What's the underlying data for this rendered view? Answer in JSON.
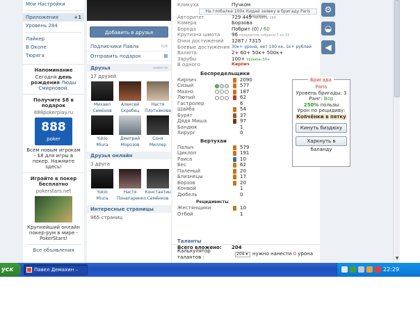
{
  "leftnav": {
    "items_top": [
      "Мои Настройки"
    ],
    "applications": {
      "label": "Приложения",
      "count": "+1"
    },
    "items_mid": [
      "Уровень 284"
    ],
    "items_links": [
      "Лайкер",
      "В Окопе",
      "Тюряга"
    ],
    "reminder": {
      "title": "Напоминание",
      "text_prefix": "Сегодня",
      "bold": "день рождения",
      "name": "Люды Смирновой."
    },
    "ad1": {
      "title": "Получите $8 в подарок",
      "site": "888pokerplay.ru",
      "logo_text": "888",
      "logo_sub": "poker",
      "text": "Всем новым игрокам - $8 для игры в покер. Нажмите здесь!"
    },
    "ad2": {
      "title": "Играйте в покер бесплатно",
      "site": "pokerstars.net",
      "text": "Крупнейший онлайн покер-рум в мире - PokerStars!"
    },
    "all_ads": "Все объявления"
  },
  "center": {
    "add_friend": "Добавить в друзья",
    "subscribers": {
      "label": "Подписчики Павла",
      "count": "628"
    },
    "send_gift": "Отправить подарок",
    "friends": {
      "title": "Друзья",
      "more": "новости",
      "count": "17 друзей",
      "people": [
        {
          "first": "Михаил",
          "last": "Семёнов"
        },
        {
          "first": "Алексей",
          "last": "Скребец"
        },
        {
          "first": "Настя",
          "last": "Плотникова"
        },
        {
          "first": "Yukio",
          "last": "Miura"
        },
        {
          "first": "Дмитрий",
          "last": "Морозов"
        },
        {
          "first": "Соня",
          "last": "Миллер"
        }
      ]
    },
    "online": {
      "title": "Друзья онлайн",
      "count": "3 друга",
      "people": [
        {
          "first": "Yukio",
          "last": "Miura"
        },
        {
          "first": "Настя",
          "last": "Понапаренко"
        },
        {
          "first": "Константин",
          "last": "Семёнков"
        }
      ]
    },
    "interesting": {
      "title": "Интересные страницы",
      "count": "965 страниц"
    }
  },
  "profile": {
    "status": "На глобалке 100к Кидай заявку в бригаду Paris Бошман",
    "rows": [
      {
        "label": "Кликуха",
        "value": "Пучком",
        "extra": ""
      },
      {
        "label": "Авторитет",
        "value": "729 449",
        "extra": "Уровень 284"
      },
      {
        "label": "Камера",
        "value": "Борзова",
        "extra": ""
      },
      {
        "label": "Борода",
        "value": "Побрит (0)",
        "extra": "60"
      },
      {
        "label": "Крутизна шмота",
        "value": "96",
        "extra": "предметов собрано 7 из 33"
      },
      {
        "label": "Очки достижений",
        "value": "1287 / 7315",
        "extra": ""
      },
      {
        "label": "Боевые достижения",
        "value": "30к+ урона, нет 100 кк, 1к+ рублей",
        "extra": ""
      },
      {
        "label": "Валюта",
        "value": "2+ 60+ 50к+ 500к+",
        "extra": ""
      },
      {
        "label": "Зарубы",
        "value": "100+",
        "extra": "Уровень 50+"
      },
      {
        "label": "В одного",
        "value": "Кирпич",
        "extra": ""
      }
    ]
  },
  "skills": {
    "title": "Беспредельщики",
    "rows": [
      {
        "label": "Кирпич",
        "circles": "none",
        "medal": "orange",
        "value": "2090"
      },
      {
        "label": "Сизый",
        "circles": "on,half,half",
        "medal": "orange",
        "value": "577"
      },
      {
        "label": "Махно",
        "circles": "empty",
        "medal": "orange",
        "value": "187"
      },
      {
        "label": "Лютый",
        "circles": "empty",
        "medal": "red",
        "value": "62"
      },
      {
        "label": "Гастролер",
        "circles": "",
        "medal": "",
        "value": "6"
      },
      {
        "label": "Шайба",
        "circles": "",
        "medal": "orange",
        "value": "54"
      },
      {
        "label": "Бурят",
        "circles": "",
        "medal": "brown",
        "value": "37"
      },
      {
        "label": "Дядя Миша",
        "circles": "",
        "medal": "dark",
        "value": "97"
      },
      {
        "label": "Бандюк",
        "circles": "",
        "medal": "",
        "value": "1"
      },
      {
        "label": "Хирург",
        "circles": "",
        "medal": "",
        "value": "0"
      }
    ]
  },
  "vertuhai": {
    "title": "Вертухаи",
    "rows": [
      {
        "label": "Палыч",
        "medal": "orange",
        "value": "579"
      },
      {
        "label": "Циклоп",
        "medal": "orange",
        "value": "191"
      },
      {
        "label": "Раиса",
        "medal": "blue",
        "value": "10"
      },
      {
        "label": "Бес",
        "medal": "orange",
        "value": "62"
      },
      {
        "label": "Паленый",
        "medal": "orange",
        "value": "20"
      },
      {
        "label": "Близнецы",
        "medal": "orange",
        "value": "17"
      },
      {
        "label": "Борзов",
        "medal": "orange",
        "value": "20"
      },
      {
        "label": "Конвой",
        "medal": "",
        "value": "1"
      },
      {
        "label": "Дюбель",
        "medal": "",
        "value": "0"
      }
    ]
  },
  "recidivists": {
    "title": "Рецидивисты",
    "rows": [
      {
        "label": "Жестянщики",
        "medal": "orange",
        "value": "10"
      },
      {
        "label": "Отбой",
        "medal": "",
        "value": "1"
      }
    ]
  },
  "brigade": {
    "title": "Бригада",
    "name": "Paris",
    "level": "Уровень бригады: 3",
    "rank_label": "Ранг:",
    "rank": "Вор",
    "percent": "250%",
    "percent_suffix": "пользы",
    "reward_label": "Урон по рецидиву:",
    "status": "Копчёнки в пятку",
    "btn_kick": "Кинуть биздюху",
    "btn_leave": "Харкнуть в баланду"
  },
  "talents": {
    "title": "Таланты",
    "invested_label": "Всего вложено:",
    "invested": "204",
    "calc_label": "Калькулятор талантов :",
    "select_value": "204",
    "need_label": "нужно нанести",
    "need_value": "0",
    "need_suffix": "урона"
  },
  "taskbar": {
    "start": "уск",
    "window": "Павел Демахин – Яа...",
    "clock": "22:29"
  },
  "colors": {
    "link": "#2b587a",
    "accent": "#5d80a8",
    "taskbar": "#245ad0"
  }
}
